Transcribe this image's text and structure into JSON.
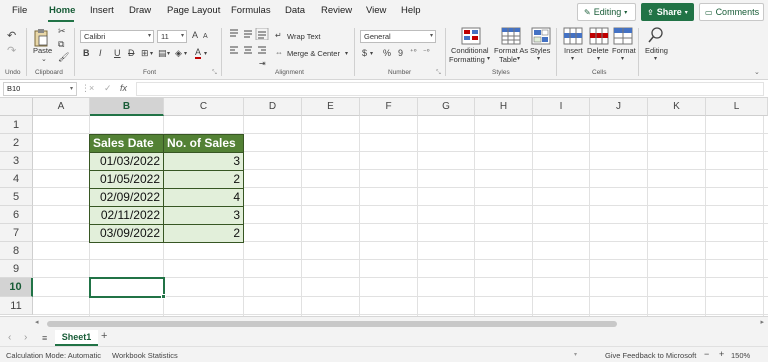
{
  "menu": {
    "items": [
      "File",
      "Home",
      "Insert",
      "Draw",
      "Page Layout",
      "Formulas",
      "Data",
      "Review",
      "View",
      "Help"
    ],
    "active": "Home",
    "editing_label": "Editing",
    "share_label": "Share",
    "comments_label": "Comments"
  },
  "ribbon": {
    "undo": {
      "label": "Undo"
    },
    "clipboard": {
      "paste_label": "Paste",
      "group_label": "Clipboard"
    },
    "font": {
      "font_name": "Calibri",
      "font_size": "11",
      "bold": "B",
      "italic": "I",
      "underline": "U",
      "strike": "D",
      "grow": "A",
      "shrink": "A",
      "font_color": "A",
      "group_label": "Font"
    },
    "alignment": {
      "wrap_text": "Wrap Text",
      "merge_center": "Merge & Center",
      "group_label": "Alignment"
    },
    "number": {
      "format": "General",
      "currency": "$",
      "percent": "%",
      "comma": "9",
      "group_label": "Number"
    },
    "styles": {
      "conditional_line1": "Conditional",
      "conditional_line2": "Formatting",
      "format_table_line1": "Format As",
      "format_table_line2": "Table",
      "styles": "Styles",
      "group_label": "Styles"
    },
    "cells": {
      "insert": "Insert",
      "delete": "Delete",
      "format": "Format",
      "group_label": "Cells"
    },
    "editing": {
      "label": "Editing"
    }
  },
  "formula_bar": {
    "name_box": "B10",
    "cancel": "×",
    "enter": "✓",
    "fx": "fx",
    "formula": ""
  },
  "grid": {
    "columns": [
      "A",
      "B",
      "C",
      "D",
      "E",
      "F",
      "G",
      "H",
      "I",
      "J",
      "K",
      "L"
    ],
    "selected_column": "B",
    "rows": [
      "1",
      "2",
      "3",
      "4",
      "5",
      "6",
      "7",
      "8",
      "9",
      "10",
      "11"
    ],
    "selected_row": "10",
    "table": {
      "headers": [
        "Sales Date",
        "No. of Sales"
      ],
      "rows": [
        {
          "date": "01/03/2022",
          "sales": "3"
        },
        {
          "date": "01/05/2022",
          "sales": "2"
        },
        {
          "date": "02/09/2022",
          "sales": "4"
        },
        {
          "date": "02/11/2022",
          "sales": "3"
        },
        {
          "date": "03/09/2022",
          "sales": "2"
        }
      ]
    },
    "colors": {
      "header_fill": "#538135",
      "data_fill": "#E2EFDA",
      "accent": "#217346"
    }
  },
  "sheets": {
    "tabs": [
      "Sheet1"
    ],
    "add": "+"
  },
  "status": {
    "calc_mode": "Calculation Mode: Automatic",
    "workbook_stats": "Workbook Statistics",
    "feedback": "Give Feedback to Microsoft",
    "zoom_minus": "−",
    "zoom_plus": "+",
    "zoom": "150%"
  }
}
